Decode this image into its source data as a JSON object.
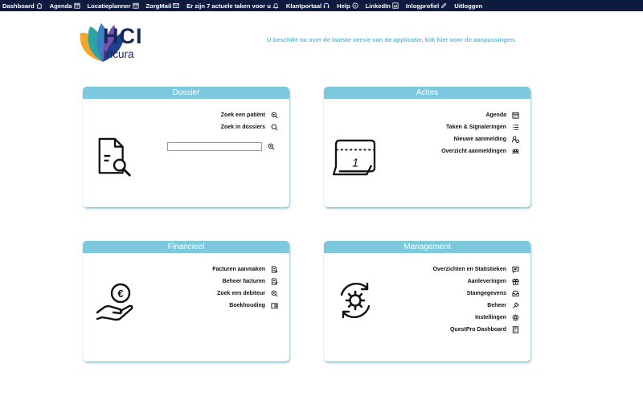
{
  "nav": {
    "items": [
      {
        "label": "Dashboard",
        "icon": "home-icon"
      },
      {
        "label": "Agenda",
        "icon": "calendar-icon"
      },
      {
        "label": "Locatieplanner",
        "icon": "calendar-icon"
      },
      {
        "label": "ZorgMail",
        "icon": "mail-icon"
      },
      {
        "label": "Er zijn 7 actuele taken voor u",
        "icon": "bell-icon"
      },
      {
        "label": "Klantportaal",
        "icon": "headset-icon"
      },
      {
        "label": "Help",
        "icon": "help-icon"
      },
      {
        "label": "LinkedIn",
        "icon": "linkedin-icon"
      },
      {
        "label": "Inlogprofiel",
        "icon": "pencil-icon"
      },
      {
        "label": "Uitloggen",
        "icon": ""
      }
    ]
  },
  "logo": {
    "name": "HCI",
    "sub": "Incura"
  },
  "update_message": "U beschikt nu over de laatste versie van de applicatie, klik hier voor de aanpassingen.",
  "cards": {
    "dossier": {
      "title": "Dossier",
      "links": [
        "Zoek een patiënt",
        "Zoek in dossiers"
      ],
      "search_value": ""
    },
    "acties": {
      "title": "Acties",
      "links": [
        "Agenda",
        "Taken & Signaleringen",
        "Nieuwe aanmelding",
        "Overzicht aanmeldingen"
      ]
    },
    "financieel": {
      "title": "Financieel",
      "links": [
        "Facturen aanmaken",
        "Beheer facturen",
        "Zoek een debiteur",
        "Boekhouding"
      ]
    },
    "management": {
      "title": "Management",
      "links": [
        "Overzichten en Statistieken",
        "Aanleveringen",
        "Stamgegevens",
        "Beheer",
        "Instellingen",
        "QuestPro Dashboard"
      ]
    }
  },
  "colors": {
    "nav_bg": "#0c1b3e",
    "accent": "#7cc8df",
    "message": "#63bdd9",
    "logo_text": "#14295a"
  }
}
